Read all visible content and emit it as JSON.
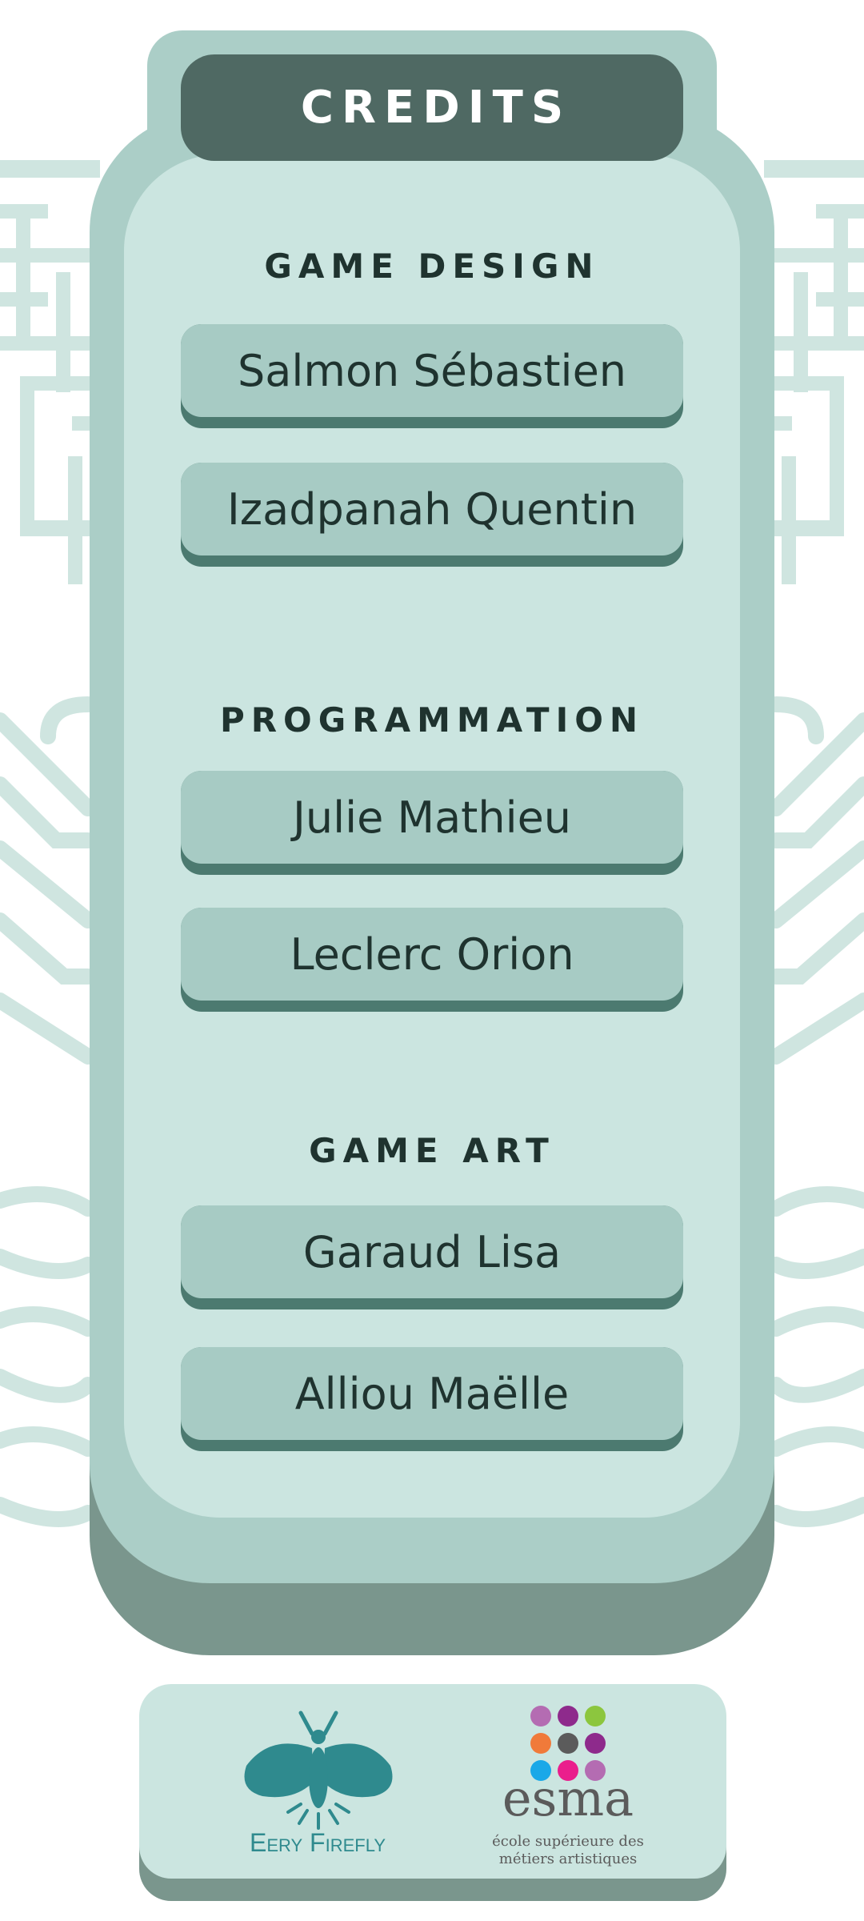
{
  "title": "CREDITS",
  "sections": [
    {
      "heading": "GAME DESIGN",
      "names": [
        "Salmon Sébastien",
        "Izadpanah Quentin"
      ]
    },
    {
      "heading": "PROGRAMMATION",
      "names": [
        "Julie Mathieu",
        "Leclerc Orion"
      ]
    },
    {
      "heading": "GAME ART",
      "names": [
        "Garaud Lisa",
        "Alliou Maëlle"
      ]
    }
  ],
  "logos": {
    "studio_name": "Eery Firefly",
    "school_name": "esma",
    "school_tagline_line1": "école supérieure des",
    "school_tagline_line2": "métiers artistiques"
  },
  "colors": {
    "panel": "#abcec7",
    "panel_inner": "#cbe5e0",
    "title_bar": "#4f6963",
    "name_card": "#a7cbc4",
    "card_shadow": "#4c7a70",
    "accent_teal": "#2f8a8e"
  }
}
